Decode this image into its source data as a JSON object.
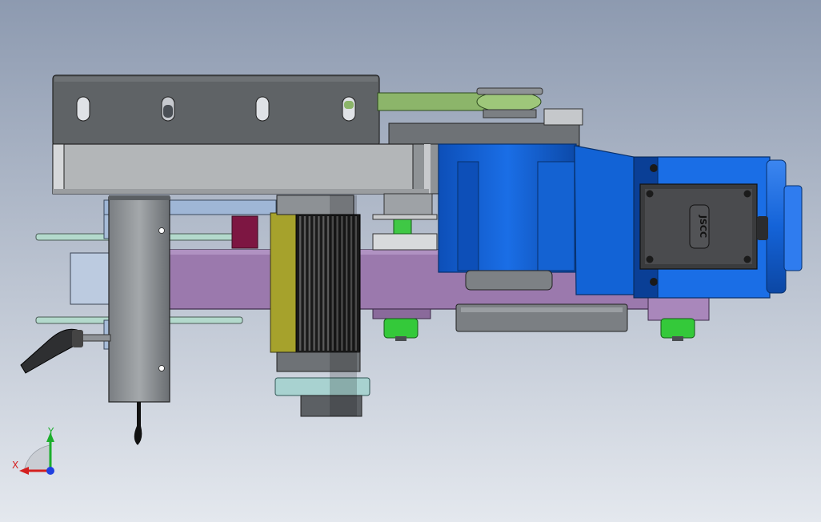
{
  "motor": {
    "label": "JSCC"
  },
  "triad": {
    "x_label": "X",
    "y_label": "Y"
  },
  "colors": {
    "background_top": "#8d9ab0",
    "background_bottom": "#e4e8ee",
    "plate_dark": "#5f6366",
    "plate_light": "#b3b6b8",
    "lilac": "#9b79ad",
    "motor_blue": "#1263d6",
    "motor_blue_dark": "#0a3f96",
    "green_link": "#8cb56a",
    "green_foot": "#34c93a",
    "olive": "#a6a22c",
    "maroon": "#7d1642",
    "light_blue": "#b7c8dc",
    "teal_disc": "#b3d9cc"
  }
}
